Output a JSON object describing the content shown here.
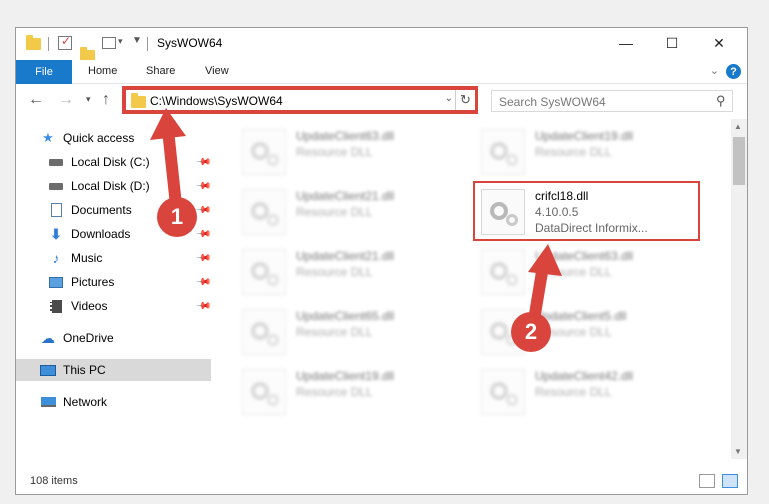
{
  "titlebar": {
    "title": "SysWOW64",
    "minimize": "—",
    "maximize": "☐",
    "close": "✕"
  },
  "ribbon": {
    "tabs": [
      "File",
      "Home",
      "Share",
      "View"
    ],
    "help": "?"
  },
  "address": {
    "path": "C:\\Windows\\SysWOW64",
    "search_placeholder": "Search SysWOW64"
  },
  "sidebar": {
    "items": [
      {
        "label": "Quick access",
        "icon": "star-icon"
      },
      {
        "label": "Local Disk (C:)",
        "icon": "drive-icon"
      },
      {
        "label": "Local Disk (D:)",
        "icon": "drive-icon"
      },
      {
        "label": "Documents",
        "icon": "documents-icon"
      },
      {
        "label": "Downloads",
        "icon": "download-icon"
      },
      {
        "label": "Music",
        "icon": "music-icon"
      },
      {
        "label": "Pictures",
        "icon": "pictures-icon"
      },
      {
        "label": "Videos",
        "icon": "videos-icon"
      },
      {
        "label": "OneDrive",
        "icon": "cloud-icon"
      },
      {
        "label": "This PC",
        "icon": "pc-icon"
      },
      {
        "label": "Network",
        "icon": "network-icon"
      }
    ]
  },
  "files": {
    "left": [
      {
        "name": "UpdateClient63.dll",
        "type": "Resource DLL"
      },
      {
        "name": "UpdateClient21.dll",
        "type": "Resource DLL"
      },
      {
        "name": "UpdateClient21.dll",
        "type": "Resource DLL"
      },
      {
        "name": "UpdateClient65.dll",
        "type": "Resource DLL"
      },
      {
        "name": "UpdateClient19.dll",
        "type": "Resource DLL"
      }
    ],
    "right": [
      {
        "name": "UpdateClient19.dll",
        "type": "Resource DLL"
      },
      {
        "name": "crifcl18.dll",
        "type": "4.10.0.5",
        "desc": "DataDirect Informix..."
      },
      {
        "name": "UpdateClient63.dll",
        "type": "Resource DLL"
      },
      {
        "name": "UpdateClient5.dll",
        "type": "Resource DLL"
      },
      {
        "name": "UpdateClient42.dll",
        "type": "Resource DLL"
      }
    ]
  },
  "status": {
    "count": "108 items"
  },
  "annotations": {
    "step1": "1",
    "step2": "2",
    "color": "#d9453d"
  }
}
